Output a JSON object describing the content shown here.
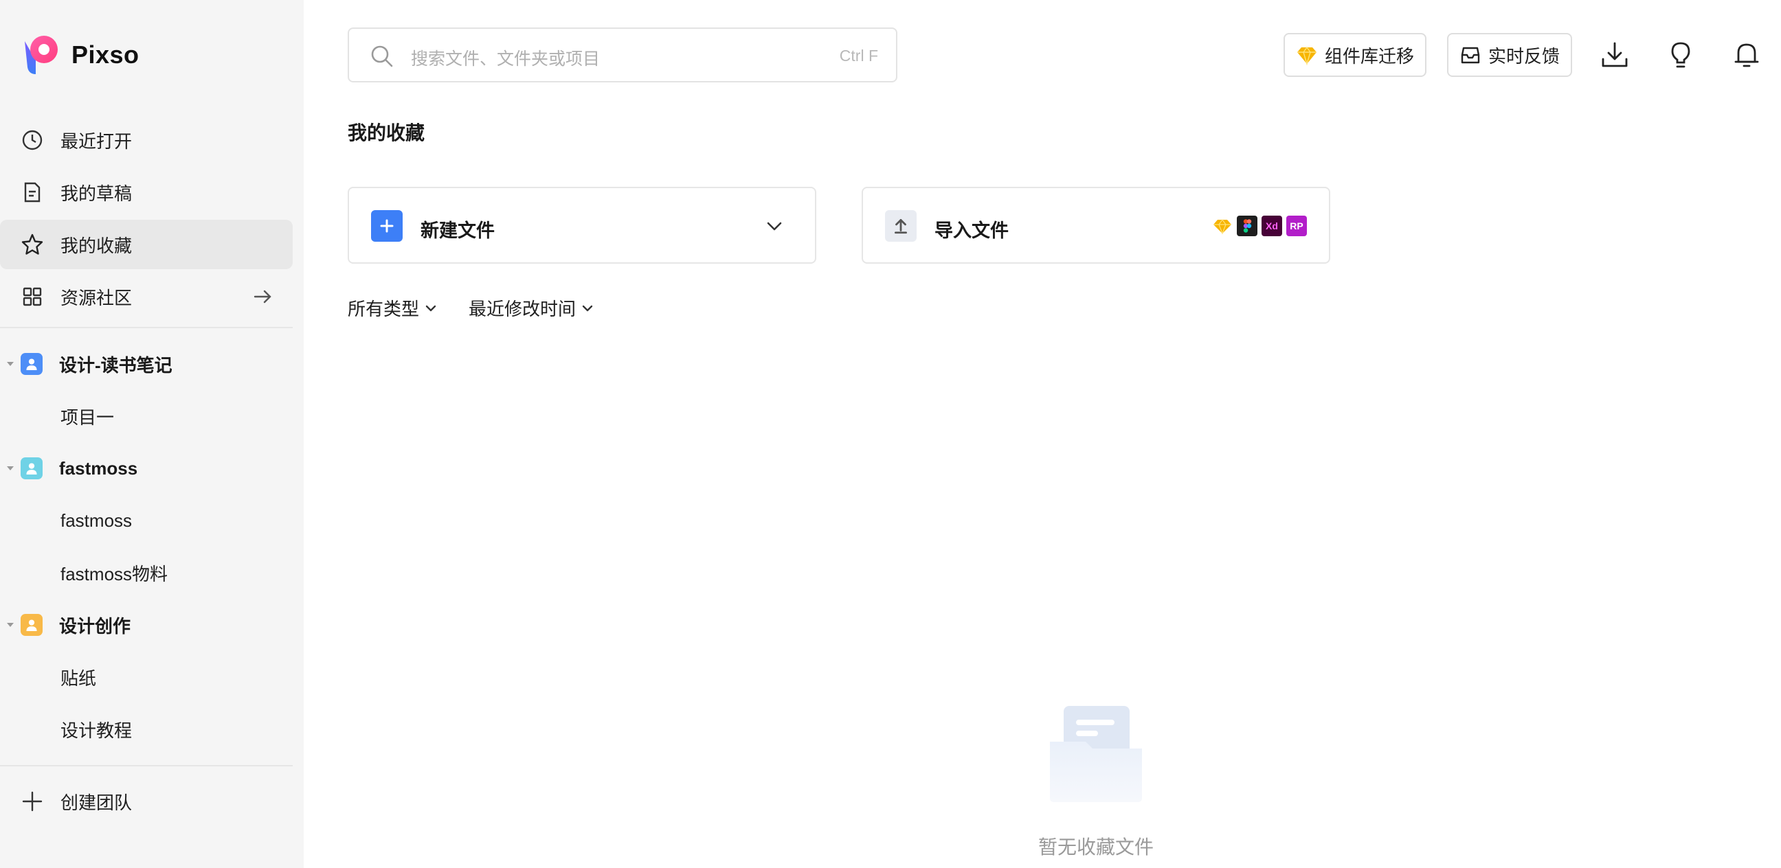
{
  "brand": {
    "name": "Pixso"
  },
  "sidebar": {
    "nav": [
      {
        "label": "最近打开",
        "icon": "clock-icon"
      },
      {
        "label": "我的草稿",
        "icon": "document-icon"
      },
      {
        "label": "我的收藏",
        "icon": "star-icon",
        "active": true
      },
      {
        "label": "资源社区",
        "icon": "grid-icon"
      }
    ],
    "teams": [
      {
        "name": "设计-读书笔记",
        "color": "#4d8ef7",
        "projects": [
          "项目一"
        ]
      },
      {
        "name": "fastmoss",
        "color": "#6fd2e6",
        "projects": [
          "fastmoss",
          "fastmoss物料"
        ]
      },
      {
        "name": "设计创作",
        "color": "#f8b948",
        "projects": [
          "贴纸",
          "设计教程"
        ]
      }
    ],
    "create_team": "创建团队"
  },
  "header": {
    "search_placeholder": "搜索文件、文件夹或项目",
    "search_shortcut": "Ctrl F",
    "migrate_button": "组件库迁移",
    "feedback_button": "实时反馈"
  },
  "main": {
    "title": "我的收藏",
    "new_file": "新建文件",
    "import_file": "导入文件",
    "import_formats": [
      "Xd",
      "RP"
    ],
    "filter_type": "所有类型",
    "filter_sort": "最近修改时间",
    "empty_text": "暂无收藏文件"
  },
  "colors": {
    "accent": "#3d7ff7",
    "sidebar_bg": "#f5f5f5"
  }
}
